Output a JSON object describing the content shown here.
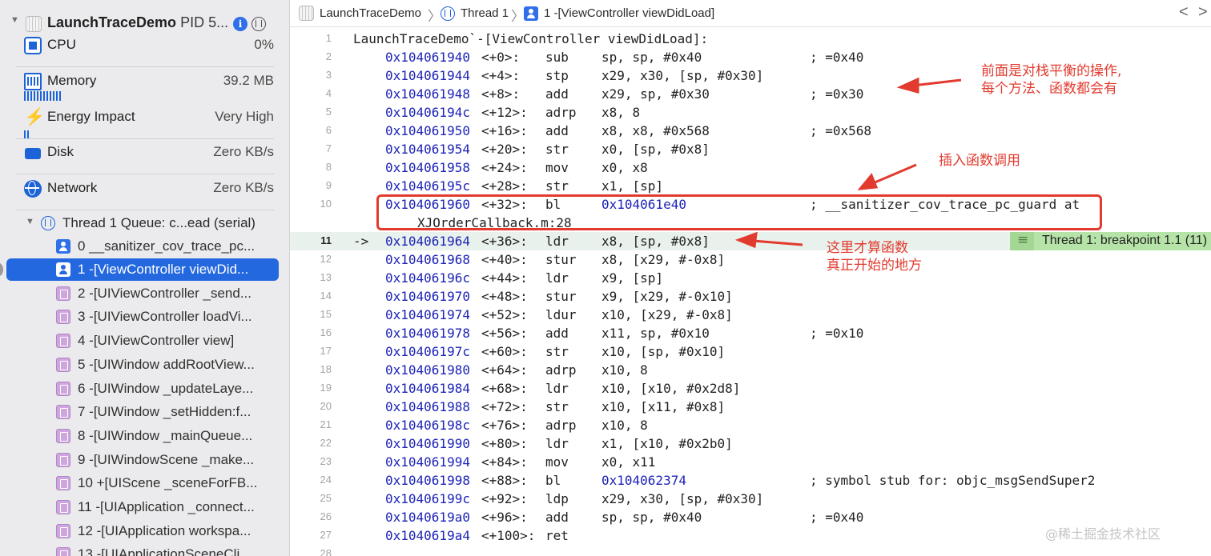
{
  "process": {
    "name": "LaunchTraceDemo",
    "pid": "PID 5..."
  },
  "gauges": {
    "cpu": {
      "label": "CPU",
      "value": "0%"
    },
    "memory": {
      "label": "Memory",
      "value": "39.2 MB"
    },
    "energy": {
      "label": "Energy Impact",
      "value": "Very High"
    },
    "disk": {
      "label": "Disk",
      "value": "Zero KB/s"
    },
    "network": {
      "label": "Network",
      "value": "Zero KB/s"
    }
  },
  "thread": {
    "label": "Thread 1 Queue: c...ead (serial)"
  },
  "frames": [
    "0 __sanitizer_cov_trace_pc...",
    "1 -[ViewController viewDid...",
    "2 -[UIViewController _send...",
    "3 -[UIViewController loadVi...",
    "4 -[UIViewController view]",
    "5 -[UIWindow addRootView...",
    "6 -[UIWindow _updateLaye...",
    "7 -[UIWindow _setHidden:f...",
    "8 -[UIWindow _mainQueue...",
    "9 -[UIWindowScene _make...",
    "10 +[UIScene _sceneForFB...",
    "11 -[UIApplication _connect...",
    "12 -[UIApplication workspa...",
    "13 -[UIApplicationSceneCli..."
  ],
  "jumpbar": {
    "app": "LaunchTraceDemo",
    "thread": "Thread 1",
    "frame": "1 -[ViewController viewDidLoad]",
    "back": "<",
    "forward": ">"
  },
  "code": {
    "header": "LaunchTraceDemo`-[ViewController viewDidLoad]:",
    "lines": [
      {
        "n": "2",
        "addr": "0x104061940",
        "off": "<+0>:",
        "mnem": "sub",
        "ops": "sp, sp, #0x40",
        "cmt": "; =0x40"
      },
      {
        "n": "3",
        "addr": "0x104061944",
        "off": "<+4>:",
        "mnem": "stp",
        "ops": "x29, x30, [sp, #0x30]",
        "cmt": ""
      },
      {
        "n": "4",
        "addr": "0x104061948",
        "off": "<+8>:",
        "mnem": "add",
        "ops": "x29, sp, #0x30",
        "cmt": "; =0x30"
      },
      {
        "n": "5",
        "addr": "0x10406194c",
        "off": "<+12>:",
        "mnem": "adrp",
        "ops": "x8, 8",
        "cmt": ""
      },
      {
        "n": "6",
        "addr": "0x104061950",
        "off": "<+16>:",
        "mnem": "add",
        "ops": "x8, x8, #0x568",
        "cmt": "; =0x568"
      },
      {
        "n": "7",
        "addr": "0x104061954",
        "off": "<+20>:",
        "mnem": "str",
        "ops": "x0, [sp, #0x8]",
        "cmt": ""
      },
      {
        "n": "8",
        "addr": "0x104061958",
        "off": "<+24>:",
        "mnem": "mov",
        "ops": "x0, x8",
        "cmt": ""
      },
      {
        "n": "9",
        "addr": "0x10406195c",
        "off": "<+28>:",
        "mnem": "str",
        "ops": "x1, [sp]",
        "cmt": ""
      },
      {
        "n": "10",
        "addr": "0x104061960",
        "off": "<+32>:",
        "mnem": "bl",
        "ops": "0x104061e40",
        "cmt": "; __sanitizer_cov_trace_pc_guard at"
      },
      {
        "n": "",
        "addr": "",
        "off": "",
        "mnem": "",
        "ops": "",
        "cmt": "",
        "cont": "XJOrderCallback.m:28"
      },
      {
        "n": "11",
        "arrow": "->",
        "addr": "0x104061964",
        "off": "<+36>:",
        "mnem": "ldr",
        "ops": "x8, [sp, #0x8]",
        "cmt": ""
      },
      {
        "n": "12",
        "addr": "0x104061968",
        "off": "<+40>:",
        "mnem": "stur",
        "ops": "x8, [x29, #-0x8]",
        "cmt": ""
      },
      {
        "n": "13",
        "addr": "0x10406196c",
        "off": "<+44>:",
        "mnem": "ldr",
        "ops": "x9, [sp]",
        "cmt": ""
      },
      {
        "n": "14",
        "addr": "0x104061970",
        "off": "<+48>:",
        "mnem": "stur",
        "ops": "x9, [x29, #-0x10]",
        "cmt": ""
      },
      {
        "n": "15",
        "addr": "0x104061974",
        "off": "<+52>:",
        "mnem": "ldur",
        "ops": "x10, [x29, #-0x8]",
        "cmt": ""
      },
      {
        "n": "16",
        "addr": "0x104061978",
        "off": "<+56>:",
        "mnem": "add",
        "ops": "x11, sp, #0x10",
        "cmt": "; =0x10"
      },
      {
        "n": "17",
        "addr": "0x10406197c",
        "off": "<+60>:",
        "mnem": "str",
        "ops": "x10, [sp, #0x10]",
        "cmt": ""
      },
      {
        "n": "18",
        "addr": "0x104061980",
        "off": "<+64>:",
        "mnem": "adrp",
        "ops": "x10, 8",
        "cmt": ""
      },
      {
        "n": "19",
        "addr": "0x104061984",
        "off": "<+68>:",
        "mnem": "ldr",
        "ops": "x10, [x10, #0x2d8]",
        "cmt": ""
      },
      {
        "n": "20",
        "addr": "0x104061988",
        "off": "<+72>:",
        "mnem": "str",
        "ops": "x10, [x11, #0x8]",
        "cmt": ""
      },
      {
        "n": "21",
        "addr": "0x10406198c",
        "off": "<+76>:",
        "mnem": "adrp",
        "ops": "x10, 8",
        "cmt": ""
      },
      {
        "n": "22",
        "addr": "0x104061990",
        "off": "<+80>:",
        "mnem": "ldr",
        "ops": "x1, [x10, #0x2b0]",
        "cmt": ""
      },
      {
        "n": "23",
        "addr": "0x104061994",
        "off": "<+84>:",
        "mnem": "mov",
        "ops": "x0, x11",
        "cmt": ""
      },
      {
        "n": "24",
        "addr": "0x104061998",
        "off": "<+88>:",
        "mnem": "bl",
        "ops": "0x104062374",
        "cmt": "; symbol stub for: objc_msgSendSuper2"
      },
      {
        "n": "25",
        "addr": "0x10406199c",
        "off": "<+92>:",
        "mnem": "ldp",
        "ops": "x29, x30, [sp, #0x30]",
        "cmt": ""
      },
      {
        "n": "26",
        "addr": "0x1040619a0",
        "off": "<+96>:",
        "mnem": "add",
        "ops": "sp, sp, #0x40",
        "cmt": "; =0x40"
      },
      {
        "n": "27",
        "addr": "0x1040619a4",
        "off": "<+100>:",
        "mnem": "ret",
        "ops": "",
        "cmt": ""
      },
      {
        "n": "28",
        "addr": "",
        "off": "",
        "mnem": "",
        "ops": "",
        "cmt": ""
      }
    ],
    "breakpoint_label": "Thread 1: breakpoint 1.1 (11)"
  },
  "annotations": {
    "stack_balance": [
      "前面是对栈平衡的操作,",
      "每个方法、函数都会有"
    ],
    "insert_call": "插入函数调用",
    "real_start": [
      "这里才算函数",
      "真正开始的地方"
    ],
    "color": "#e23a2e"
  },
  "watermark": "@稀土掘金技术社区"
}
